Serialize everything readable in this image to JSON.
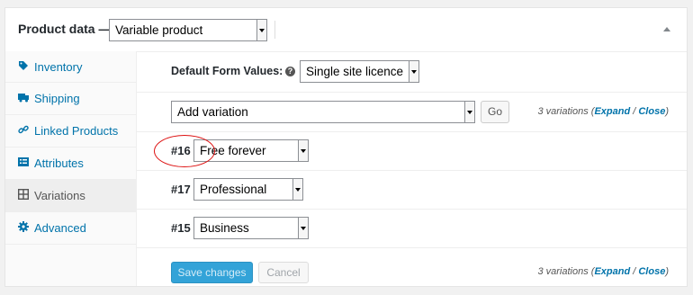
{
  "header": {
    "title": "Product data —",
    "product_type": "Variable product"
  },
  "sidebar": {
    "items": [
      {
        "label": "Inventory",
        "icon": "tag-icon",
        "active": false
      },
      {
        "label": "Shipping",
        "icon": "truck-icon",
        "active": false
      },
      {
        "label": "Linked Products",
        "icon": "link-icon",
        "active": false
      },
      {
        "label": "Attributes",
        "icon": "list-icon",
        "active": false
      },
      {
        "label": "Variations",
        "icon": "grid-icon",
        "active": true
      },
      {
        "label": "Advanced",
        "icon": "gear-icon",
        "active": false
      }
    ]
  },
  "defaults": {
    "label": "Default Form Values:",
    "help": "?",
    "value": "Single site licence"
  },
  "toolbar": {
    "action_select": "Add variation",
    "go_label": "Go",
    "summary_prefix": "3 variations (",
    "expand": "Expand",
    "sep": " / ",
    "close": "Close",
    "summary_suffix": ")"
  },
  "variations": [
    {
      "id": "#16",
      "value": "Free forever"
    },
    {
      "id": "#17",
      "value": "Professional"
    },
    {
      "id": "#15",
      "value": "Business"
    }
  ],
  "footer": {
    "save_label": "Save changes",
    "cancel_label": "Cancel"
  },
  "colors": {
    "link": "#0073aa",
    "primary_button": "#33a3d8",
    "annotation": "#dd1111"
  }
}
